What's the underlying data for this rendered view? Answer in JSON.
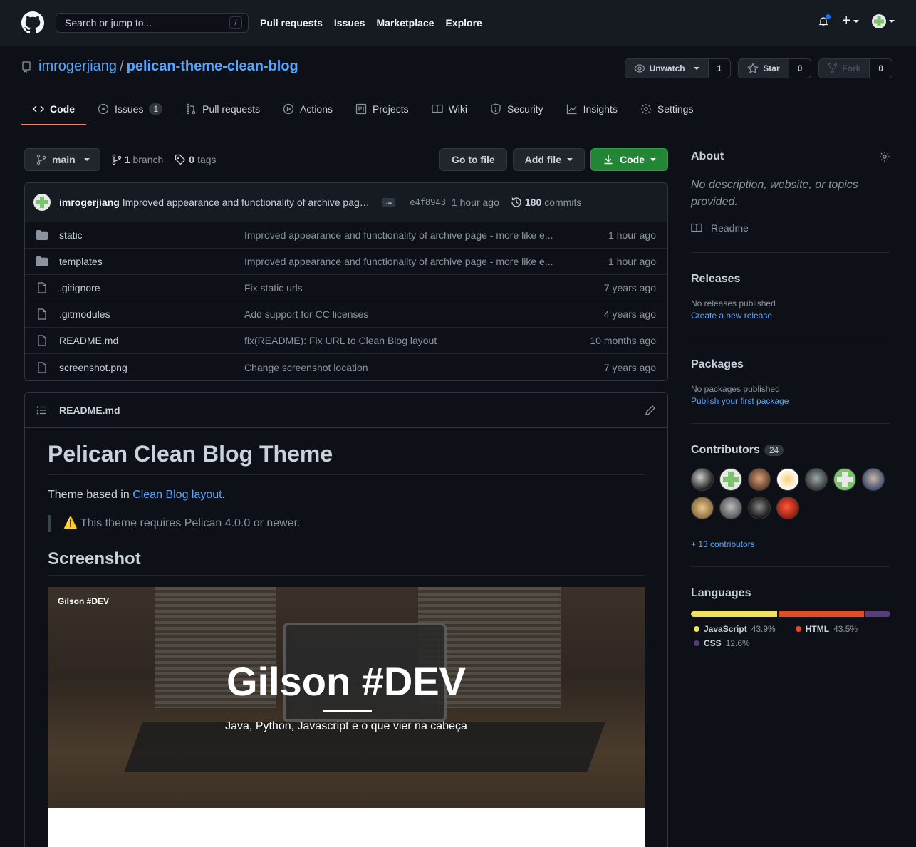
{
  "header": {
    "search_placeholder": "Search or jump to...",
    "search_key": "/",
    "nav": [
      "Pull requests",
      "Issues",
      "Marketplace",
      "Explore"
    ]
  },
  "repo": {
    "owner": "imrogerjiang",
    "separator": "/",
    "name": "pelican-theme-clean-blog",
    "watch_label": "Unwatch",
    "watch_count": "1",
    "star_label": "Star",
    "star_count": "0",
    "fork_label": "Fork",
    "fork_count": "0"
  },
  "tabs": [
    {
      "label": "Code",
      "icon": "code-icon"
    },
    {
      "label": "Issues",
      "icon": "issue-icon",
      "count": "1"
    },
    {
      "label": "Pull requests",
      "icon": "pull-request-icon"
    },
    {
      "label": "Actions",
      "icon": "play-icon"
    },
    {
      "label": "Projects",
      "icon": "project-icon"
    },
    {
      "label": "Wiki",
      "icon": "book-icon"
    },
    {
      "label": "Security",
      "icon": "shield-icon"
    },
    {
      "label": "Insights",
      "icon": "graph-icon"
    },
    {
      "label": "Settings",
      "icon": "gear-icon"
    }
  ],
  "branchbar": {
    "branch": "main",
    "branch_count": "1",
    "branch_word": "branch",
    "tag_count": "0",
    "tag_word": "tags",
    "go_to_file": "Go to file",
    "add_file": "Add file",
    "code": "Code"
  },
  "latest_commit": {
    "author": "imrogerjiang",
    "message": "Improved appearance and functionality of archive page - more lik...",
    "ellipsis": "...",
    "sha": "e4f8943",
    "time": "1 hour ago",
    "commit_count": "180",
    "commit_word": "commits"
  },
  "files": [
    {
      "type": "dir",
      "name": "static",
      "message": "Improved appearance and functionality of archive page - more like e...",
      "age": "1 hour ago"
    },
    {
      "type": "dir",
      "name": "templates",
      "message": "Improved appearance and functionality of archive page - more like e...",
      "age": "1 hour ago"
    },
    {
      "type": "file",
      "name": ".gitignore",
      "message": "Fix static urls",
      "age": "7 years ago"
    },
    {
      "type": "file",
      "name": ".gitmodules",
      "message": "Add support for CC licenses",
      "age": "4 years ago"
    },
    {
      "type": "file",
      "name": "README.md",
      "message": "fix(README): Fix URL to Clean Blog layout",
      "age": "10 months ago"
    },
    {
      "type": "file",
      "name": "screenshot.png",
      "message": "Change screenshot location",
      "age": "7 years ago"
    }
  ],
  "readme": {
    "filename": "README.md",
    "h1": "Pelican Clean Blog Theme",
    "intro_prefix": "Theme based in ",
    "intro_link": "Clean Blog layout",
    "intro_suffix": ".",
    "warning_icon": "⚠️",
    "warning_text": "This theme requires Pelican 4.0.0 or newer.",
    "h2": "Screenshot",
    "shot_brand": "Gilson #DEV",
    "shot_title": "Gilson #DEV",
    "shot_sub": "Java, Python, Javascript e o que vier na cabeça"
  },
  "sidebar": {
    "about_title": "About",
    "about_desc": "No description, website, or topics provided.",
    "readme_link": "Readme",
    "releases_title": "Releases",
    "releases_none": "No releases published",
    "releases_link": "Create a new release",
    "packages_title": "Packages",
    "packages_none": "No packages published",
    "packages_link": "Publish your first package",
    "contributors_title": "Contributors",
    "contributors_count": "24",
    "contributors_more": "+ 13 contributors",
    "languages_title": "Languages",
    "languages": [
      {
        "name": "JavaScript",
        "percent": "43.9%",
        "value": 43.9,
        "color": "#f1e05a"
      },
      {
        "name": "HTML",
        "percent": "43.5%",
        "value": 43.5,
        "color": "#e34c26"
      },
      {
        "name": "CSS",
        "percent": "12.6%",
        "value": 12.6,
        "color": "#563d7c"
      }
    ]
  },
  "colors": {
    "accent_link": "#58a6ff",
    "tab_underline": "#f78166",
    "code_button": "#238636"
  }
}
